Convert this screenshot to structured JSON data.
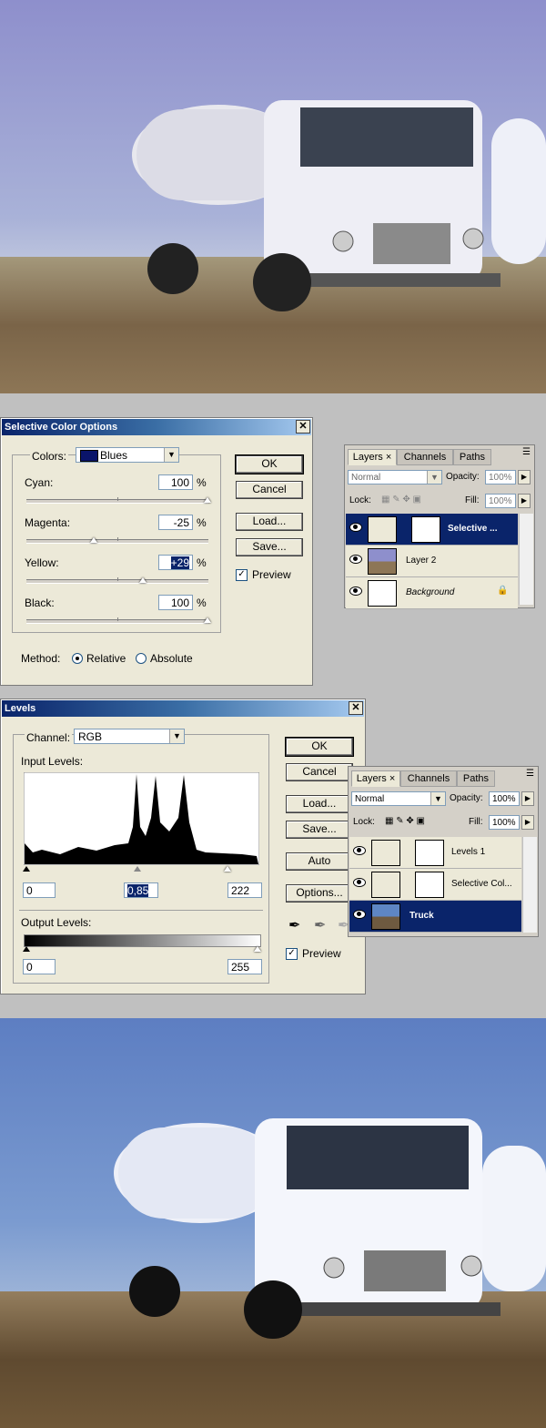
{
  "selective_color": {
    "title": "Selective Color Options",
    "colors_label": "Colors:",
    "colors_value": "Blues",
    "colors_swatch": "#0a146a",
    "cyan_label": "Cyan:",
    "cyan_value": "100",
    "magenta_label": "Magenta:",
    "magenta_value": "-25",
    "yellow_label": "Yellow:",
    "yellow_value": "+29",
    "black_label": "Black:",
    "black_value": "100",
    "percent": "%",
    "method_label": "Method:",
    "relative_label": "Relative",
    "absolute_label": "Absolute",
    "ok": "OK",
    "cancel": "Cancel",
    "load": "Load...",
    "save": "Save...",
    "preview": "Preview",
    "close_glyph": "✕"
  },
  "layers1": {
    "tabs": [
      "Layers",
      "Channels",
      "Paths"
    ],
    "tab_close": "×",
    "blend_mode": "Normal",
    "opacity_label": "Opacity:",
    "opacity_value": "100%",
    "lock_label": "Lock:",
    "fill_label": "Fill:",
    "fill_value": "100%",
    "rows": [
      "Selective ...",
      "Layer 2",
      "Background"
    ]
  },
  "levels": {
    "title": "Levels",
    "channel_label": "Channel:",
    "channel_value": "RGB",
    "input_label": "Input Levels:",
    "input_black": "0",
    "input_gamma": "0,85",
    "input_white": "222",
    "output_label": "Output Levels:",
    "output_black": "0",
    "output_white": "255",
    "ok": "OK",
    "cancel": "Cancel",
    "load": "Load...",
    "save": "Save...",
    "auto": "Auto",
    "options": "Options...",
    "preview": "Preview",
    "close_glyph": "✕"
  },
  "layers2": {
    "tabs": [
      "Layers",
      "Channels",
      "Paths"
    ],
    "tab_close": "×",
    "blend_mode": "Normal",
    "opacity_label": "Opacity:",
    "opacity_value": "100%",
    "lock_label": "Lock:",
    "fill_label": "Fill:",
    "fill_value": "100%",
    "rows": [
      "Levels 1",
      "Selective Col...",
      "Truck"
    ]
  },
  "colors": {
    "selection": "#0a246a",
    "sky_top": "#8895c6",
    "sky_bottom_after": "#5e86c4"
  }
}
